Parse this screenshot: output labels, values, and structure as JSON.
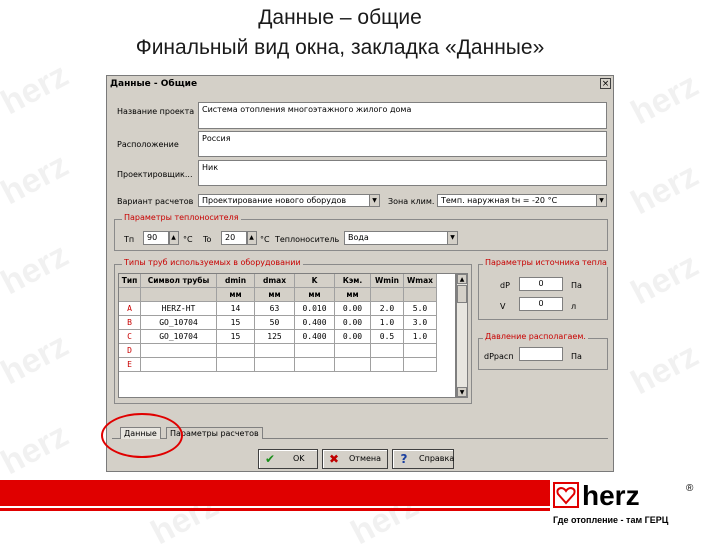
{
  "slide": {
    "title_line1": "Данные – общие",
    "title_line2": "Финальный вид окна, закладка «Данные»",
    "watermark": "herz"
  },
  "window": {
    "title": "Данные - Общие",
    "close": "×"
  },
  "form": {
    "project_name_label": "Название проекта",
    "project_name_value": "Система отопления многоэтажного жилого дома",
    "location_label": "Расположение",
    "location_value": "Россия",
    "designer_label": "Проектировщик...",
    "designer_value": "Ник",
    "calc_variant_label": "Вариант расчетов",
    "calc_variant_value": "Проектирование нового оборудов",
    "climate_zone_label": "Зона клим.",
    "climate_zone_value": "Темп. наружная tн = -20 °С"
  },
  "coolant": {
    "group_title": "Параметры теплоносителя",
    "tp_label": "Tп",
    "tp_value": "90",
    "tp_unit": "°С",
    "to_label": "To",
    "to_value": "20",
    "to_unit": "°С",
    "medium_label": "Теплоноситель",
    "medium_value": "Вода"
  },
  "pipes": {
    "group_title": "Типы труб используемых в оборудовании",
    "columns": [
      "Тип",
      "Символ трубы",
      "dmin",
      "dmax",
      "K",
      "Кэм.",
      "Wmin",
      "Wmax"
    ],
    "units": [
      "",
      "",
      "мм",
      "мм",
      "мм",
      "мм",
      "",
      ""
    ],
    "rows": [
      [
        "A",
        "HERZ-HT",
        "14",
        "63",
        "0.010",
        "0.00",
        "2.0",
        "5.0"
      ],
      [
        "B",
        "GO_10704",
        "15",
        "50",
        "0.400",
        "0.00",
        "1.0",
        "3.0"
      ],
      [
        "C",
        "GO_10704",
        "15",
        "125",
        "0.400",
        "0.00",
        "0.5",
        "1.0"
      ],
      [
        "D",
        "",
        "",
        "",
        "",
        "",
        "",
        ""
      ],
      [
        "E",
        "",
        "",
        "",
        "",
        "",
        "",
        ""
      ]
    ]
  },
  "source": {
    "group_title": "Параметры источника тепла",
    "dp_label": "dP",
    "dp_value": "0",
    "dp_unit": "Па",
    "v_label": "V",
    "v_value": "0",
    "v_unit": "л"
  },
  "available": {
    "group_title": "Давление располагаем.",
    "label": "dPрасп",
    "value": "",
    "unit": "Па"
  },
  "tabs": {
    "data": "Данные",
    "calc_params": "Параметры расчетов"
  },
  "buttons": {
    "ok": "OK",
    "cancel": "Отмена",
    "help": "Справка"
  },
  "branding": {
    "logo_text": "herz",
    "registered": "®",
    "tagline": "Где отопление - там ГЕРЦ"
  },
  "colors": {
    "accent_red": "#e00000",
    "dialog_gray": "#d4d0c8"
  }
}
